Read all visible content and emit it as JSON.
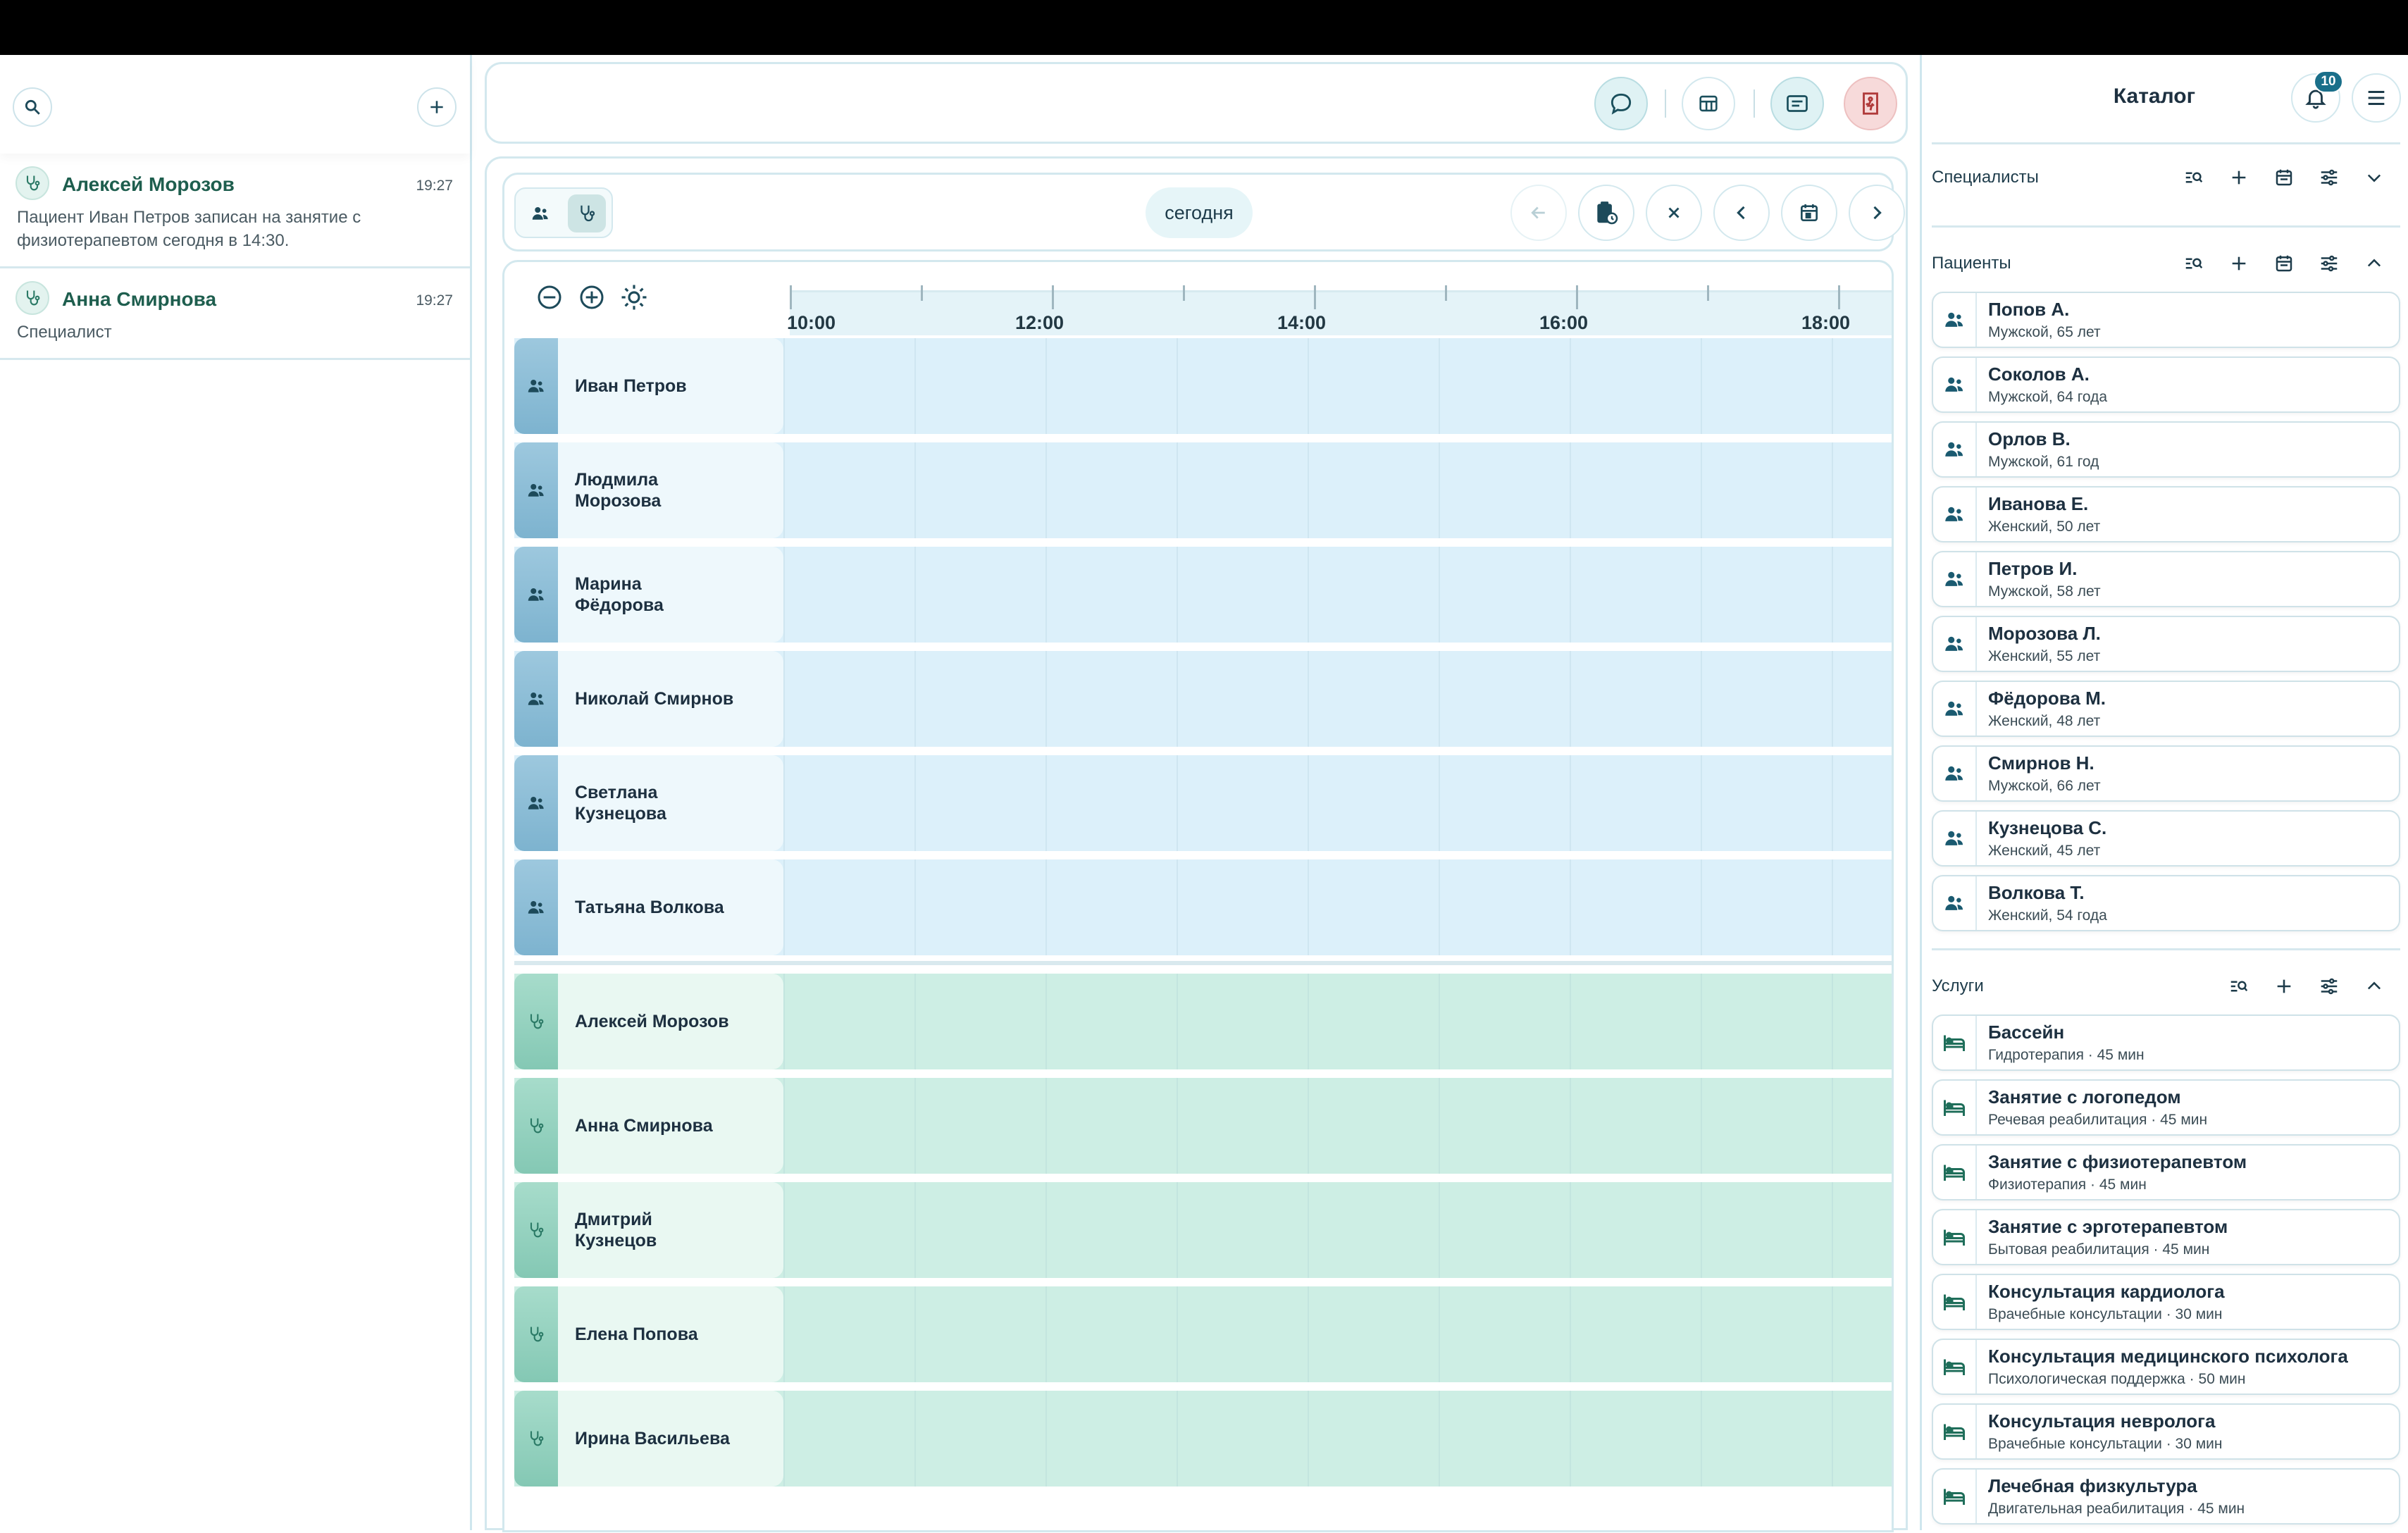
{
  "left_panel": {
    "chats": [
      {
        "name": "Алексей Морозов",
        "time": "19:27",
        "message": "Пациент Иван Петров записан на занятие с физиотерапевтом сегодня в 14:30."
      },
      {
        "name": "Анна Смирнова",
        "time": "19:27",
        "message": "Специалист"
      }
    ]
  },
  "schedule": {
    "today_label": "сегодня",
    "time_labels": [
      "10:00",
      "12:00",
      "14:00",
      "16:00",
      "18:00"
    ],
    "patients": [
      "Иван Петров",
      "Людмила\nМорозова",
      "Марина\nФёдорова",
      "Николай Смирнов",
      "Светлана\nКузнецова",
      "Татьяна Волкова"
    ],
    "specialists": [
      "Алексей Морозов",
      "Анна Смирнова",
      "Дмитрий\nКузнецов",
      "Елена Попова",
      "Ирина Васильева"
    ]
  },
  "right_panel": {
    "title": "Каталог",
    "notification_count": "10",
    "sections": {
      "specialists": "Специалисты",
      "patients": "Пациенты",
      "services": "Услуги"
    },
    "patients": [
      {
        "name": "Попов А.",
        "info": "Мужской, 65 лет"
      },
      {
        "name": "Соколов А.",
        "info": "Мужской, 64 года"
      },
      {
        "name": "Орлов В.",
        "info": "Мужской, 61 год"
      },
      {
        "name": "Иванова Е.",
        "info": "Женский, 50 лет"
      },
      {
        "name": "Петров И.",
        "info": "Мужской, 58 лет"
      },
      {
        "name": "Морозова Л.",
        "info": "Женский, 55 лет"
      },
      {
        "name": "Фёдорова М.",
        "info": "Женский, 48 лет"
      },
      {
        "name": "Смирнов Н.",
        "info": "Мужской, 66 лет"
      },
      {
        "name": "Кузнецова С.",
        "info": "Женский, 45 лет"
      },
      {
        "name": "Волкова Т.",
        "info": "Женский, 54 года"
      }
    ],
    "services": [
      {
        "name": "Бассейн",
        "info": "Гидротерапия · 45 мин"
      },
      {
        "name": "Занятие с логопедом",
        "info": "Речевая реабилитация · 45 мин"
      },
      {
        "name": "Занятие с физиотерапевтом",
        "info": "Физиотерапия · 45 мин"
      },
      {
        "name": "Занятие с эрготерапевтом",
        "info": "Бытовая реабилитация · 45 мин"
      },
      {
        "name": "Консультация кардиолога",
        "info": "Врачебные консультации · 30 мин"
      },
      {
        "name": "Консультация медицинского психолога",
        "info": "Психологическая поддержка · 50 мин"
      },
      {
        "name": "Консультация невролога",
        "info": "Врачебные консультации · 30 мин"
      },
      {
        "name": "Лечебная физкультура",
        "info": "Двигательная реабилитация · 45 мин"
      }
    ]
  },
  "colors": {
    "accent": "#1a6f8a",
    "patient_lane": "#dcf0fa",
    "specialist_lane": "#cdeee4",
    "exit_button": "#f7dada"
  }
}
